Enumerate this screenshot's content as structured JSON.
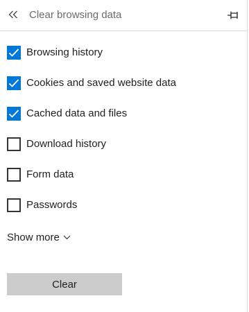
{
  "header": {
    "title": "Clear browsing data",
    "back_icon": "double-chevron-left-icon",
    "pin_icon": "pin-icon"
  },
  "options": [
    {
      "label": "Browsing history",
      "checked": true
    },
    {
      "label": "Cookies and saved website data",
      "checked": true
    },
    {
      "label": "Cached data and files",
      "checked": true
    },
    {
      "label": "Download history",
      "checked": false
    },
    {
      "label": "Form data",
      "checked": false
    },
    {
      "label": "Passwords",
      "checked": false
    }
  ],
  "show_more": {
    "label": "Show more",
    "icon": "chevron-down-icon"
  },
  "clear_button": {
    "label": "Clear"
  },
  "colors": {
    "accent": "#0078d7",
    "button_bg": "#cccccc"
  }
}
